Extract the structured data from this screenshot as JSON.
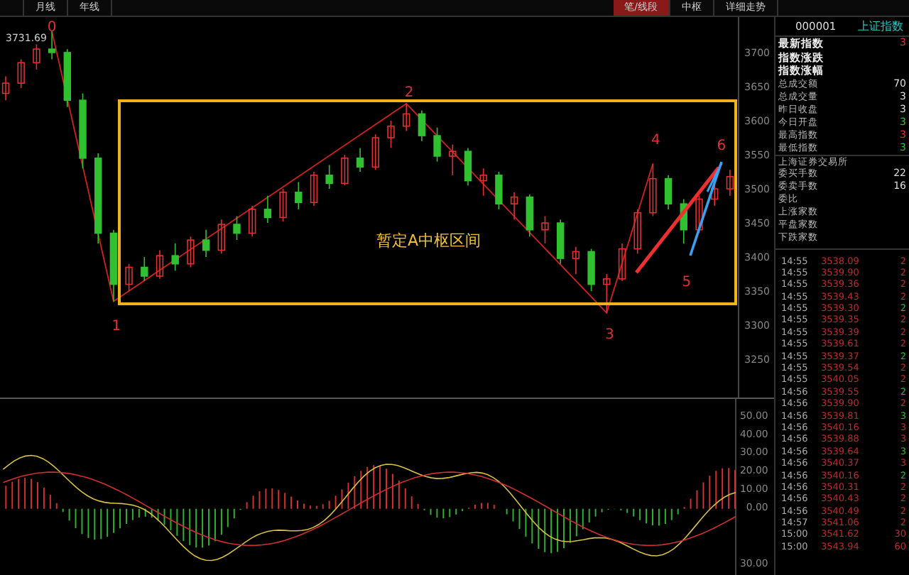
{
  "top_bar": {
    "left_tabs": [
      {
        "label": "月线",
        "selected": false
      },
      {
        "label": "年线",
        "selected": false
      }
    ],
    "right_tabs": [
      {
        "label": "笔/线段",
        "selected": true
      },
      {
        "label": "中枢",
        "selected": false
      },
      {
        "label": "详细走势",
        "selected": false
      }
    ]
  },
  "chart": {
    "high_label": "3731.69",
    "zone_label": "暂定A中枢区间",
    "wave_labels": [
      "0",
      "1",
      "2",
      "3",
      "4",
      "5",
      "6"
    ],
    "chart_data": {
      "type": "candlestick",
      "ylim": [
        3194,
        3752
      ],
      "yticks": [
        3700,
        3650,
        3600,
        3550,
        3500,
        3450,
        3400,
        3350,
        3300,
        3250
      ],
      "ohlc": [
        [
          3640,
          3665,
          3630,
          3655
        ],
        [
          3655,
          3690,
          3648,
          3685
        ],
        [
          3685,
          3712,
          3675,
          3705
        ],
        [
          3705,
          3731,
          3690,
          3700
        ],
        [
          3700,
          3705,
          3620,
          3630
        ],
        [
          3630,
          3640,
          3530,
          3545
        ],
        [
          3545,
          3552,
          3420,
          3435
        ],
        [
          3435,
          3440,
          3335,
          3360
        ],
        [
          3360,
          3390,
          3350,
          3385
        ],
        [
          3385,
          3400,
          3365,
          3372
        ],
        [
          3372,
          3410,
          3368,
          3402
        ],
        [
          3402,
          3420,
          3380,
          3390
        ],
        [
          3390,
          3430,
          3385,
          3425
        ],
        [
          3425,
          3440,
          3400,
          3410
        ],
        [
          3410,
          3455,
          3405,
          3448
        ],
        [
          3448,
          3460,
          3425,
          3435
        ],
        [
          3435,
          3475,
          3430,
          3470
        ],
        [
          3470,
          3490,
          3450,
          3458
        ],
        [
          3458,
          3500,
          3452,
          3495
        ],
        [
          3495,
          3510,
          3470,
          3480
        ],
        [
          3480,
          3525,
          3475,
          3520
        ],
        [
          3520,
          3535,
          3500,
          3508
        ],
        [
          3508,
          3550,
          3505,
          3545
        ],
        [
          3545,
          3560,
          3525,
          3532
        ],
        [
          3532,
          3580,
          3528,
          3575
        ],
        [
          3575,
          3600,
          3560,
          3592
        ],
        [
          3592,
          3625,
          3585,
          3610
        ],
        [
          3610,
          3615,
          3570,
          3578
        ],
        [
          3578,
          3590,
          3540,
          3548
        ],
        [
          3548,
          3565,
          3520,
          3555
        ],
        [
          3555,
          3560,
          3505,
          3512
        ],
        [
          3512,
          3530,
          3490,
          3520
        ],
        [
          3520,
          3525,
          3470,
          3478
        ],
        [
          3478,
          3495,
          3455,
          3488
        ],
        [
          3488,
          3492,
          3430,
          3440
        ],
        [
          3440,
          3460,
          3420,
          3450
        ],
        [
          3450,
          3455,
          3390,
          3398
        ],
        [
          3398,
          3415,
          3375,
          3408
        ],
        [
          3408,
          3412,
          3350,
          3360
        ],
        [
          3360,
          3375,
          3318,
          3368
        ],
        [
          3368,
          3420,
          3365,
          3412
        ],
        [
          3412,
          3470,
          3405,
          3465
        ],
        [
          3465,
          3537,
          3460,
          3515
        ],
        [
          3515,
          3520,
          3470,
          3478
        ],
        [
          3478,
          3485,
          3420,
          3440
        ],
        [
          3440,
          3490,
          3435,
          3485
        ],
        [
          3485,
          3510,
          3475,
          3500
        ],
        [
          3500,
          3528,
          3490,
          3518
        ]
      ]
    }
  },
  "macd": {
    "axis": [
      "50.00",
      "40.00",
      "30.00",
      "20.00",
      "10.00",
      "0.00",
      "30.00"
    ]
  },
  "quote": {
    "code": "000001",
    "name": "上证指数",
    "rows": [
      {
        "kind": "main",
        "label": "最新指数",
        "value": "3",
        "color": "#e03030"
      },
      {
        "kind": "main",
        "label": "指数涨跌"
      },
      {
        "kind": "main",
        "label": "指数涨幅"
      },
      {
        "kind": "normal",
        "label": "总成交额",
        "value": "70",
        "color": "#dddddd"
      },
      {
        "kind": "normal",
        "label": "总成交量",
        "value": "3",
        "color": "#dddddd"
      },
      {
        "kind": "normal",
        "label": "昨日收盘",
        "value": "3",
        "color": "#dddddd"
      },
      {
        "kind": "normal",
        "label": "今日开盘",
        "value": "3",
        "color": "#30c030"
      },
      {
        "kind": "normal",
        "label": "最高指数",
        "value": "3",
        "color": "#e03030"
      },
      {
        "kind": "normal",
        "label": "最低指数",
        "value": "3",
        "color": "#30c030"
      },
      {
        "kind": "header",
        "label": "上海证券交易所"
      },
      {
        "kind": "normal",
        "label": "委买手数",
        "value": "22",
        "color": "#dddddd"
      },
      {
        "kind": "normal",
        "label": "委卖手数",
        "value": "16",
        "color": "#dddddd"
      },
      {
        "kind": "normal",
        "label": "委比"
      },
      {
        "kind": "normal",
        "label": "上涨家数"
      },
      {
        "kind": "normal",
        "label": "平盘家数"
      },
      {
        "kind": "normal",
        "label": "下跌家数"
      }
    ]
  },
  "ticks": [
    {
      "time": "14:55",
      "price": "3538.09",
      "volume": "2",
      "up": true
    },
    {
      "time": "14:55",
      "price": "3539.90",
      "volume": "2",
      "up": true
    },
    {
      "time": "14:55",
      "price": "3539.36",
      "volume": "2",
      "up": true
    },
    {
      "time": "14:55",
      "price": "3539.43",
      "volume": "2",
      "up": true
    },
    {
      "time": "14:55",
      "price": "3539.30",
      "volume": "2",
      "up": false
    },
    {
      "time": "14:55",
      "price": "3539.35",
      "volume": "2",
      "up": true
    },
    {
      "time": "14:55",
      "price": "3539.39",
      "volume": "2",
      "up": true
    },
    {
      "time": "14:55",
      "price": "3539.61",
      "volume": "2",
      "up": true
    },
    {
      "time": "14:55",
      "price": "3539.37",
      "volume": "2",
      "up": false
    },
    {
      "time": "14:55",
      "price": "3539.54",
      "volume": "2",
      "up": true
    },
    {
      "time": "14:55",
      "price": "3540.05",
      "volume": "2",
      "up": true
    },
    {
      "time": "14:56",
      "price": "3539.55",
      "volume": "2",
      "up": false
    },
    {
      "time": "14:56",
      "price": "3539.90",
      "volume": "2",
      "up": true
    },
    {
      "time": "14:56",
      "price": "3539.81",
      "volume": "3",
      "up": false
    },
    {
      "time": "14:56",
      "price": "3540.16",
      "volume": "3",
      "up": true
    },
    {
      "time": "14:56",
      "price": "3539.88",
      "volume": "3",
      "up": true
    },
    {
      "time": "14:56",
      "price": "3539.64",
      "volume": "3",
      "up": false
    },
    {
      "time": "14:56",
      "price": "3540.37",
      "volume": "3",
      "up": true
    },
    {
      "time": "14:56",
      "price": "3540.16",
      "volume": "2",
      "up": false
    },
    {
      "time": "14:56",
      "price": "3540.31",
      "volume": "2",
      "up": true
    },
    {
      "time": "14:56",
      "price": "3540.43",
      "volume": "2",
      "up": true
    },
    {
      "time": "14:56",
      "price": "3540.49",
      "volume": "2",
      "up": true
    },
    {
      "time": "14:57",
      "price": "3541.06",
      "volume": "2",
      "up": true
    },
    {
      "time": "15:00",
      "price": "3541.62",
      "volume": "30",
      "up": true
    },
    {
      "time": "15:00",
      "price": "3543.94",
      "volume": "60",
      "up": true
    }
  ]
}
